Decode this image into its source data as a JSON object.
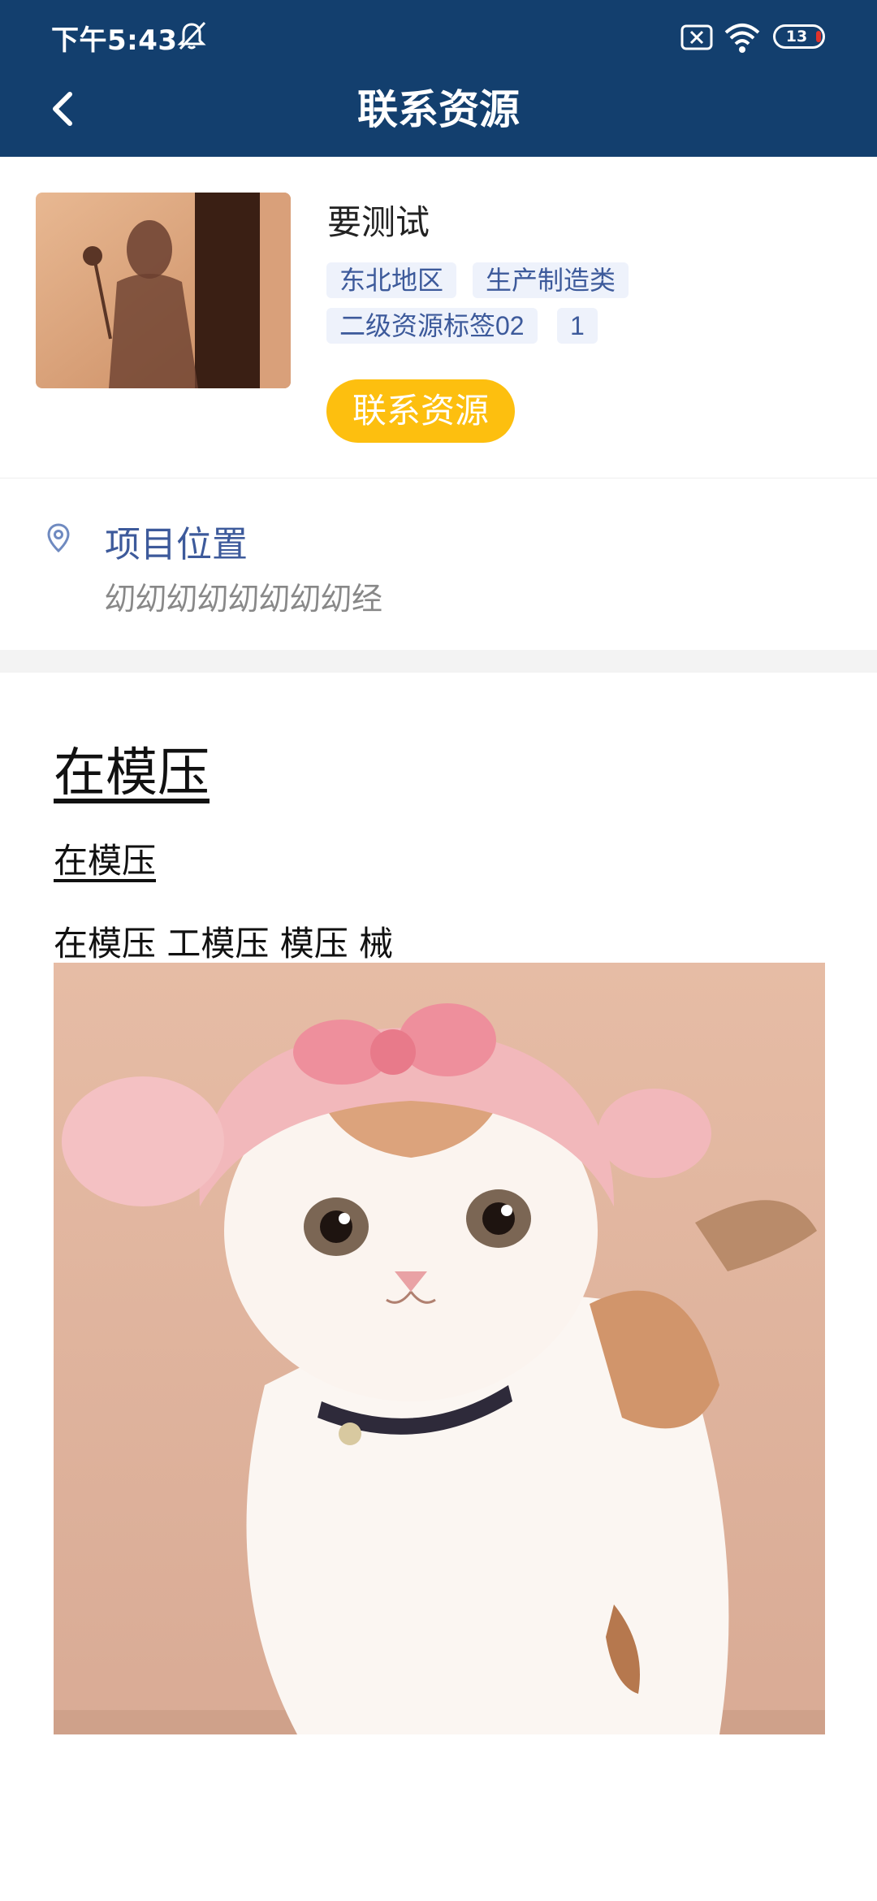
{
  "status_bar": {
    "time": "下午5:43",
    "battery": "13"
  },
  "header": {
    "title": "联系资源",
    "back_icon": "chevron-left-icon"
  },
  "resource": {
    "name": "要测试",
    "tags": [
      "东北地区",
      "生产制造类",
      "二级资源标签02",
      "1"
    ],
    "contact_label": "联系资源"
  },
  "location": {
    "icon": "location-pin-icon",
    "title": "项目位置",
    "value": "㓜㓜㓜㓜㓜㓜㓜㓜经"
  },
  "content": {
    "heading1": "在模压",
    "heading2": "在模压",
    "paragraph": "在模压  工模压 模压 械"
  },
  "colors": {
    "header_bg": "#133f6e",
    "accent_button": "#fdbf0f",
    "tag_text": "#3d5a9b",
    "tag_bg": "#eef2fb"
  }
}
